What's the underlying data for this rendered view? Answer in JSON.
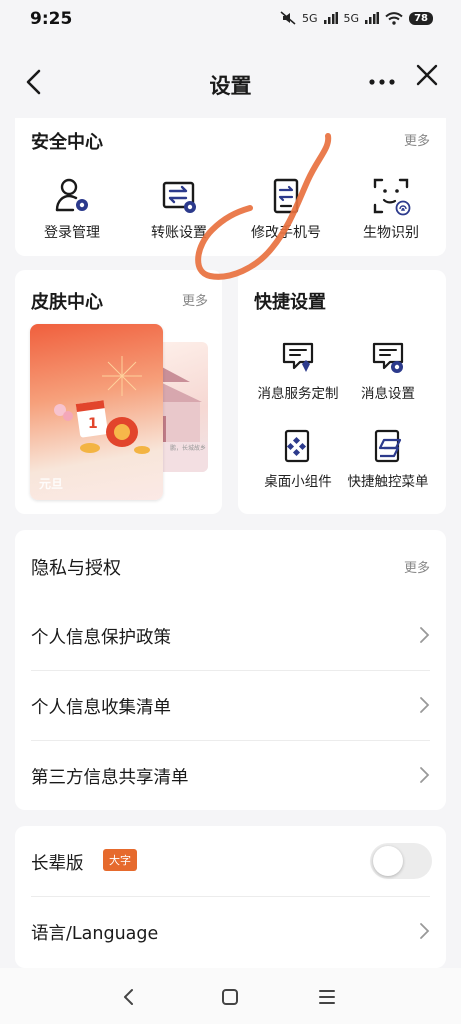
{
  "status": {
    "time": "9:25",
    "signal1": "5G",
    "signal2": "5G",
    "battery": "78"
  },
  "nav": {
    "title": "设置"
  },
  "security": {
    "title": "安全中心",
    "more": "更多",
    "items": [
      {
        "label": "登录管理",
        "icon": "user-gear-icon"
      },
      {
        "label": "转账设置",
        "icon": "transfer-settings-icon"
      },
      {
        "label": "修改手机号",
        "icon": "phone-swap-icon"
      },
      {
        "label": "生物识别",
        "icon": "face-fingerprint-icon"
      }
    ]
  },
  "skin": {
    "title": "皮肤中心",
    "more": "更多",
    "theme_label": "元旦",
    "preview_note": "鹏，长城故乡"
  },
  "shortcuts": {
    "title": "快捷设置",
    "items": [
      {
        "label": "消息服务定制",
        "icon": "message-custom-icon"
      },
      {
        "label": "消息设置",
        "icon": "message-settings-icon"
      },
      {
        "label": "桌面小组件",
        "icon": "desktop-widget-icon"
      },
      {
        "label": "快捷触控菜单",
        "icon": "quick-touch-icon"
      }
    ]
  },
  "privacy": {
    "title": "隐私与授权",
    "more": "更多",
    "rows": [
      "个人信息保护政策",
      "个人信息收集清单",
      "第三方信息共享清单"
    ]
  },
  "elder": {
    "label": "长辈版",
    "badge": "大字",
    "toggle_on": false
  },
  "language": {
    "label": "语言/Language"
  },
  "colors": {
    "accent_blue": "#2c3a8c",
    "accent_orange": "#e66a2d",
    "annotation": "#e8713f"
  }
}
